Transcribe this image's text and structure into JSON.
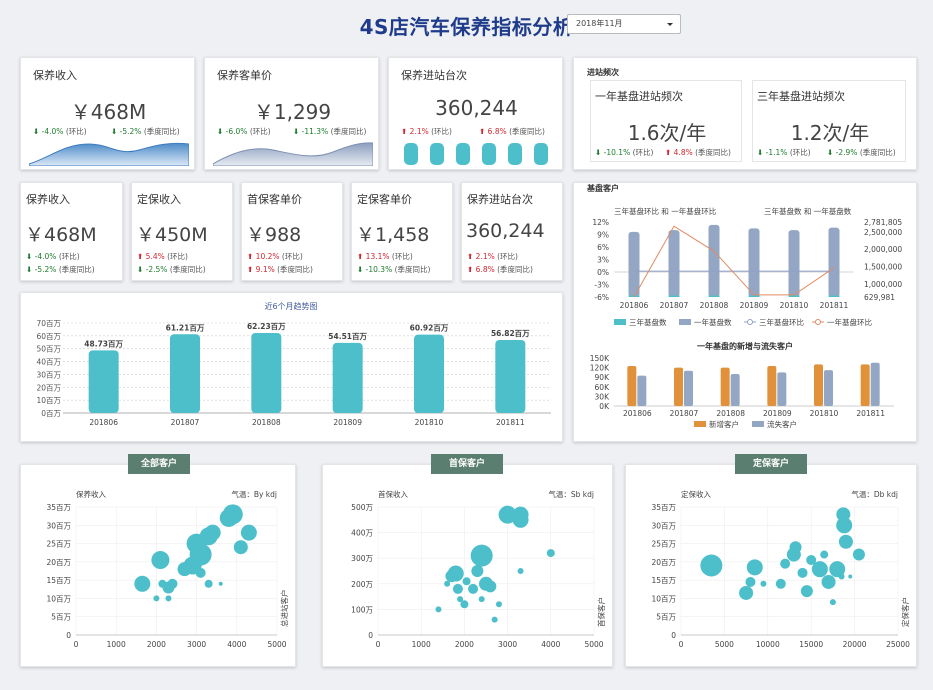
{
  "header": {
    "title": "4S店汽车保养指标分析",
    "period": "2018年11月"
  },
  "top": {
    "revenue": {
      "label": "保养收入",
      "value": "￥468M",
      "mom": "-4.0%",
      "mom_tag": "(环比)",
      "yoy": "-5.2%",
      "yoy_tag": "(季度同比)"
    },
    "price": {
      "label": "保养客单价",
      "value": "￥1,299",
      "mom": "-6.0%",
      "mom_tag": "(环比)",
      "yoy": "-11.3%",
      "yoy_tag": "(季度同比)"
    },
    "visits": {
      "label": "保养进站台次",
      "value": "360,244",
      "mom": "2.1%",
      "mom_tag": "(环比)",
      "yoy": "6.8%",
      "yoy_tag": "(季度同比)"
    }
  },
  "freq": {
    "section": "进站频次",
    "one": {
      "label": "一年基盘进站频次",
      "value": "1.6次/年",
      "mom": "-10.1%",
      "mom_tag": "(环比)",
      "yoy": "4.8%",
      "yoy_tag": "(季度同比)"
    },
    "three": {
      "label": "三年基盘进站频次",
      "value": "1.2次/年",
      "mom": "-1.1%",
      "mom_tag": "(环比)",
      "yoy": "-2.9%",
      "yoy_tag": "(季度同比)"
    }
  },
  "kpis": [
    {
      "label": "保养收入",
      "value": "￥468M",
      "a": "-4.0%",
      "a_tag": "(环比)",
      "a_dir": "down",
      "b": "-5.2%",
      "b_tag": "(季度同比)",
      "b_dir": "down"
    },
    {
      "label": "定保收入",
      "value": "￥450M",
      "a": "5.4%",
      "a_tag": "(环比)",
      "a_dir": "up",
      "b": "-2.5%",
      "b_tag": "(季度同比)",
      "b_dir": "down"
    },
    {
      "label": "首保客单价",
      "value": "￥988",
      "a": "10.2%",
      "a_tag": "(环比)",
      "a_dir": "up",
      "b": "9.1%",
      "b_tag": "(季度同比)",
      "b_dir": "up"
    },
    {
      "label": "定保客单价",
      "value": "￥1,458",
      "a": "13.1%",
      "a_tag": "(环比)",
      "a_dir": "up",
      "b": "-10.3%",
      "b_tag": "(季度同比)",
      "b_dir": "down"
    },
    {
      "label": "保养进站台次",
      "value": "360,244",
      "a": "2.1%",
      "a_tag": "(环比)",
      "a_dir": "up",
      "b": "6.8%",
      "b_tag": "(季度同比)",
      "b_dir": "up"
    }
  ],
  "base_section": "基盘客户",
  "bubble_titles": [
    "全部客户",
    "首保客户",
    "定保客户"
  ],
  "chart_data": [
    {
      "type": "bar",
      "title": "近6个月趋势图",
      "categories": [
        "201806",
        "201807",
        "201808",
        "201809",
        "201810",
        "201811"
      ],
      "values": [
        48.73,
        61.21,
        62.23,
        54.51,
        60.92,
        56.82
      ],
      "value_labels": [
        "48.73百万",
        "61.21百万",
        "62.23百万",
        "54.51百万",
        "60.92百万",
        "56.82百万"
      ],
      "ylim": [
        0,
        70
      ],
      "yticks": [
        "0百万",
        "10百万",
        "20百万",
        "30百万",
        "40百万",
        "50百万",
        "60百万",
        "70百万"
      ],
      "grid": true
    },
    {
      "type": "bar",
      "subtitle_left": "三年基盘环比 和 一年基盘环比",
      "subtitle_right": "三年基盘数 和 一年基盘数",
      "categories": [
        "201806",
        "201807",
        "201808",
        "201809",
        "201810",
        "201811"
      ],
      "series": [
        {
          "name": "三年基盘数",
          "type": "bar",
          "values": [
            629981,
            629981,
            629981,
            629981,
            629981,
            629981
          ]
        },
        {
          "name": "一年基盘数",
          "type": "bar",
          "values": [
            2500000,
            2550000,
            2700000,
            2600000,
            2550000,
            2620000
          ]
        },
        {
          "name": "三年基盘环比",
          "type": "line",
          "values": [
            0.2,
            0.2,
            0.2,
            0.2,
            0.2,
            0.2
          ]
        },
        {
          "name": "一年基盘环比",
          "type": "line",
          "values": [
            -6,
            11,
            5,
            -5.5,
            -5.5,
            1
          ]
        }
      ],
      "yleft_ticks": [
        "12%",
        "9%",
        "6%",
        "3%",
        "0%",
        "-3%",
        "-6%"
      ],
      "yleft_lim": [
        -6,
        12
      ],
      "yright_ticks": [
        "2,781,805",
        "2,500,000",
        "2,000,000",
        "1,500,000",
        "1,000,000",
        "629,981"
      ],
      "yright_lim": [
        629981,
        2781805
      ],
      "legend": "bottom"
    },
    {
      "type": "bar",
      "title": "一年基盘的新增与流失客户",
      "categories": [
        "201806",
        "201807",
        "201808",
        "201809",
        "201810",
        "201811"
      ],
      "series": [
        {
          "name": "新增客户",
          "values": [
            125000,
            120000,
            120000,
            125000,
            130000,
            130000
          ]
        },
        {
          "name": "流失客户",
          "values": [
            95000,
            110000,
            100000,
            105000,
            112000,
            135000
          ]
        }
      ],
      "yticks": [
        "0K",
        "30K",
        "60K",
        "90K",
        "120K",
        "150K"
      ],
      "ylim": [
        0,
        150000
      ],
      "legend": "bottom"
    },
    {
      "type": "scatter",
      "title": "全部客户",
      "ylabel": "保养收入",
      "ylabel_right": "总进站客户",
      "filter": "气温：By kdj",
      "xlim": [
        0,
        5000
      ],
      "xticks": [
        "0",
        "1000",
        "2000",
        "3000",
        "4000",
        "5000"
      ],
      "ylim": [
        0,
        35
      ],
      "yticks": [
        "0",
        "5百万",
        "10百万",
        "15百万",
        "20百万",
        "25百万",
        "30百万",
        "35百万"
      ],
      "points": [
        [
          1650,
          14,
          8
        ],
        [
          2000,
          10,
          3
        ],
        [
          2150,
          14,
          4
        ],
        [
          2300,
          13,
          6
        ],
        [
          2400,
          14,
          5
        ],
        [
          2100,
          20.5,
          9
        ],
        [
          2300,
          10,
          3
        ],
        [
          2700,
          18,
          7
        ],
        [
          2900,
          19,
          9
        ],
        [
          3000,
          25,
          10
        ],
        [
          3100,
          22,
          11
        ],
        [
          3300,
          27,
          9
        ],
        [
          3400,
          28,
          8
        ],
        [
          3100,
          17,
          5
        ],
        [
          3300,
          14,
          4
        ],
        [
          3600,
          14,
          2
        ],
        [
          3800,
          32,
          9
        ],
        [
          4100,
          24,
          7
        ],
        [
          4300,
          28,
          8
        ],
        [
          3900,
          33,
          10
        ]
      ]
    },
    {
      "type": "scatter",
      "title": "首保客户",
      "ylabel": "首保收入",
      "ylabel_right": "首保客户",
      "filter": "气温：Sb kdj",
      "xlim": [
        0,
        5000
      ],
      "xticks": [
        "0",
        "1000",
        "2000",
        "3000",
        "4000",
        "5000"
      ],
      "ylim": [
        0,
        500
      ],
      "yticks": [
        "0",
        "100万",
        "200万",
        "300万",
        "400万",
        "500万"
      ],
      "points": [
        [
          1400,
          100,
          3
        ],
        [
          1600,
          200,
          3
        ],
        [
          1700,
          230,
          6
        ],
        [
          1800,
          240,
          8
        ],
        [
          1850,
          180,
          5
        ],
        [
          1900,
          140,
          3
        ],
        [
          2000,
          120,
          4
        ],
        [
          2050,
          210,
          4
        ],
        [
          2200,
          180,
          5
        ],
        [
          2300,
          250,
          6
        ],
        [
          2400,
          310,
          11
        ],
        [
          2400,
          140,
          3
        ],
        [
          2500,
          200,
          7
        ],
        [
          2600,
          190,
          6
        ],
        [
          2700,
          60,
          3
        ],
        [
          2800,
          120,
          3
        ],
        [
          3000,
          470,
          9
        ],
        [
          3300,
          470,
          8
        ],
        [
          3300,
          450,
          8
        ],
        [
          3300,
          250,
          3
        ],
        [
          4000,
          320,
          4
        ]
      ]
    },
    {
      "type": "scatter",
      "title": "定保客户",
      "ylabel": "定保收入",
      "ylabel_right": "定保客户",
      "filter": "气温：Db kdj",
      "xlim": [
        0,
        25000
      ],
      "xticks": [
        "0",
        "5000",
        "10000",
        "15000",
        "20000",
        "25000"
      ],
      "ylim": [
        0,
        35
      ],
      "yticks": [
        "0",
        "5百万",
        "10百万",
        "15百万",
        "20百万",
        "25百万",
        "30百万",
        "35百万"
      ],
      "points": [
        [
          3500,
          19,
          11
        ],
        [
          7500,
          11.5,
          7
        ],
        [
          8000,
          14.5,
          5
        ],
        [
          8500,
          18.5,
          8
        ],
        [
          9500,
          14,
          3
        ],
        [
          11500,
          14,
          5
        ],
        [
          12000,
          19.5,
          5
        ],
        [
          13000,
          22,
          7
        ],
        [
          13200,
          24,
          6
        ],
        [
          14000,
          17,
          5
        ],
        [
          14500,
          12,
          6
        ],
        [
          15000,
          20.5,
          5
        ],
        [
          16000,
          18,
          8
        ],
        [
          16500,
          22,
          4
        ],
        [
          17000,
          14.5,
          7
        ],
        [
          18000,
          18,
          8
        ],
        [
          18500,
          16,
          3
        ],
        [
          19000,
          25.5,
          7
        ],
        [
          18800,
          30,
          8
        ],
        [
          18700,
          33,
          7
        ],
        [
          20500,
          22,
          6
        ],
        [
          17500,
          9,
          3
        ],
        [
          19500,
          16,
          2
        ]
      ]
    }
  ]
}
